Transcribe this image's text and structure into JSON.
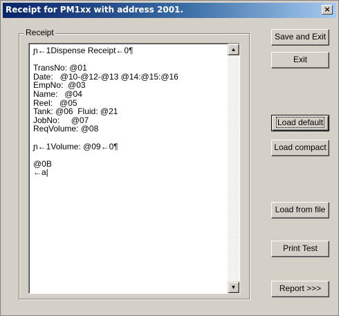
{
  "window": {
    "title": "Receipt for PM1xx with address 2001.",
    "close_glyph": "×"
  },
  "receipt_group": {
    "label": "Receipt",
    "lines": [
      "ɲ←1Dispense Receipt←0¶",
      "",
      "TransNo: @01",
      "Date:   @10-@12-@13 @14:@15:@16",
      "EmpNo:  @03",
      "Name:   @04",
      "Reel:   @05",
      "Tank: @06  Fluid: @21",
      "JobNo:     @07",
      "ReqVolume: @08",
      "",
      "ɲ←1Volume: @09←0¶",
      "",
      "@0B",
      "←a|"
    ],
    "scroll_up_glyph": "▲",
    "scroll_down_glyph": "▼"
  },
  "buttons": {
    "save_exit": "Save and Exit",
    "exit": "Exit",
    "load_default": "Load default",
    "load_compact": "Load compact",
    "load_file": "Load from file",
    "print_test": "Print Test",
    "report": "Report >>>"
  }
}
